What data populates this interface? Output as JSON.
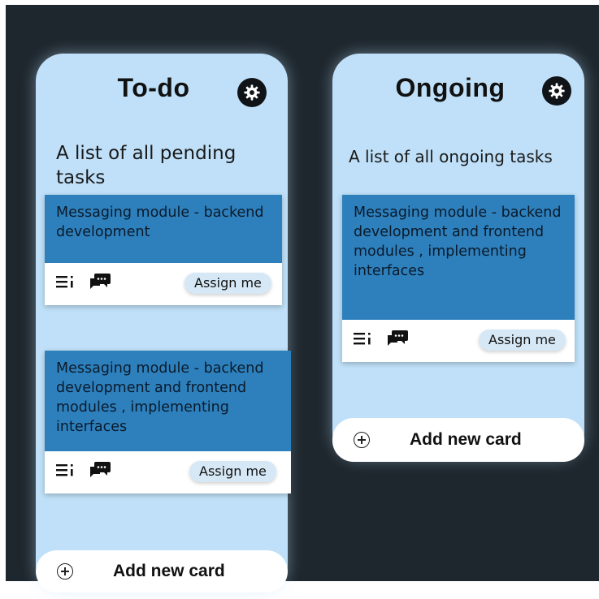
{
  "board": {
    "columns": [
      {
        "title": "To-do",
        "description": "A list of all pending tasks",
        "add_card_label": "Add new card",
        "cards": [
          {
            "text": "Messaging module - backend development",
            "assign_label": "Assign me"
          },
          {
            "text": "Messaging module - backend development and frontend modules , implementing interfaces",
            "assign_label": "Assign me"
          }
        ]
      },
      {
        "title": "Ongoing",
        "description": "A list of all ongoing tasks",
        "add_card_label": "Add new card",
        "cards": [
          {
            "text": "Messaging module - backend development and frontend modules , implementing interfaces",
            "assign_label": "Assign me"
          }
        ]
      }
    ]
  },
  "icons": {
    "settings": "gear-icon",
    "details": "list-icon",
    "comments": "chat-icon",
    "add": "plus-circle-icon"
  },
  "colors": {
    "background": "#1e272e",
    "column": "#bfe0f8",
    "card_top": "#2e80bd",
    "assign_button": "#d6e8f5"
  }
}
